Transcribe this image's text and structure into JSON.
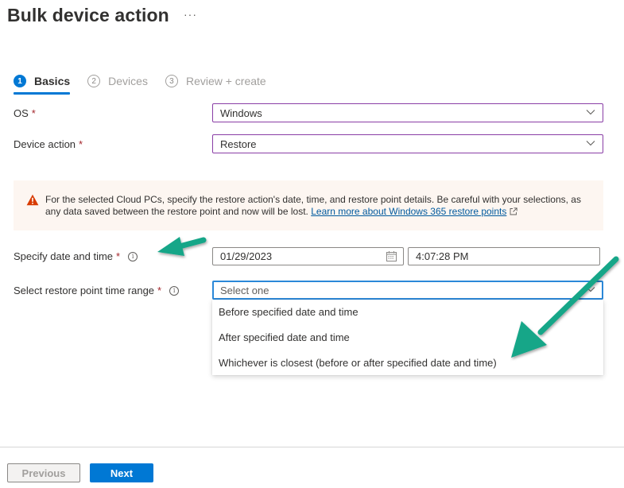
{
  "header": {
    "title": "Bulk device action",
    "more_label": "···"
  },
  "steps": [
    {
      "number": "1",
      "label": "Basics",
      "active": true
    },
    {
      "number": "2",
      "label": "Devices",
      "active": false
    },
    {
      "number": "3",
      "label": "Review + create",
      "active": false
    }
  ],
  "form": {
    "os": {
      "label": "OS",
      "required_mark": "*",
      "value": "Windows"
    },
    "device_action": {
      "label": "Device action",
      "required_mark": "*",
      "value": "Restore"
    },
    "warning": {
      "text": "For the selected Cloud PCs, specify the restore action's date, time, and restore point details. Be careful with your selections, as any data saved between the restore point and now will be lost. ",
      "link_text": "Learn more about Windows 365 restore points",
      "icon": "warning-icon",
      "color": "#d83b01"
    },
    "date_time": {
      "label": "Specify date and time",
      "required_mark": "*",
      "date_value": "01/29/2023",
      "time_value": "4:07:28 PM"
    },
    "time_range": {
      "label": "Select restore point time range",
      "required_mark": "*",
      "placeholder": "Select one",
      "options": [
        "Before specified date and time",
        "After specified date and time",
        "Whichever is closest (before or after specified date and time)"
      ]
    }
  },
  "footer": {
    "previous_label": "Previous",
    "next_label": "Next"
  },
  "colors": {
    "accent": "#0078d4",
    "select_border": "#8a3ea6",
    "focus_border": "#2b88d8",
    "warning_bg": "#fdf6f1",
    "annotation_arrow": "#12a688"
  }
}
